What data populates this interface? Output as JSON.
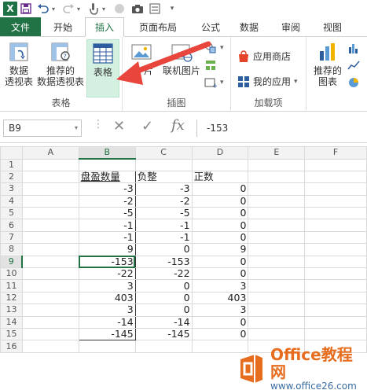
{
  "quick_access": {
    "logo": "X"
  },
  "tabs": [
    {
      "label": "文件"
    },
    {
      "label": "开始"
    },
    {
      "label": "插入"
    },
    {
      "label": "页面布局"
    },
    {
      "label": "公式"
    },
    {
      "label": "数据"
    },
    {
      "label": "审阅"
    },
    {
      "label": "视图"
    }
  ],
  "ribbon": {
    "tables_group": {
      "label": "表格",
      "pivot_line1": "数据",
      "pivot_line2": "透视表",
      "rec_pivot_line1": "推荐的",
      "rec_pivot_line2": "数据透视表",
      "table_label": "表格"
    },
    "illustrations_group": {
      "label": "插图",
      "pictures_suffix": "片",
      "online_pictures": "联机图片"
    },
    "addins_group": {
      "label": "加载项",
      "store": "应用商店",
      "my_apps": "我的应用"
    },
    "charts_group": {
      "rec_charts_line1": "推荐的",
      "rec_charts_line2": "图表"
    }
  },
  "formula_bar": {
    "name_box": "B9",
    "fx": "fx",
    "value": "-153"
  },
  "columns": [
    "A",
    "B",
    "C",
    "D",
    "E",
    "F"
  ],
  "rows": [
    {
      "n": "1",
      "A": "",
      "B": "",
      "C": "",
      "D": ""
    },
    {
      "n": "2",
      "A": "",
      "B": "盘盈数量",
      "C": "负整",
      "D": "正数"
    },
    {
      "n": "3",
      "A": "",
      "B": "-3",
      "C": "-3",
      "D": "0"
    },
    {
      "n": "4",
      "A": "",
      "B": "-2",
      "C": "-2",
      "D": "0"
    },
    {
      "n": "5",
      "A": "",
      "B": "-5",
      "C": "-5",
      "D": "0"
    },
    {
      "n": "6",
      "A": "",
      "B": "-1",
      "C": "-1",
      "D": "0"
    },
    {
      "n": "7",
      "A": "",
      "B": "-1",
      "C": "-1",
      "D": "0"
    },
    {
      "n": "8",
      "A": "",
      "B": "9",
      "C": "0",
      "D": "9"
    },
    {
      "n": "9",
      "A": "",
      "B": "-153",
      "C": "-153",
      "D": "0"
    },
    {
      "n": "10",
      "A": "",
      "B": "-22",
      "C": "-22",
      "D": "0"
    },
    {
      "n": "11",
      "A": "",
      "B": "3",
      "C": "0",
      "D": "3"
    },
    {
      "n": "12",
      "A": "",
      "B": "403",
      "C": "0",
      "D": "403"
    },
    {
      "n": "13",
      "A": "",
      "B": "3",
      "C": "0",
      "D": "3"
    },
    {
      "n": "14",
      "A": "",
      "B": "-14",
      "C": "-14",
      "D": "0"
    },
    {
      "n": "15",
      "A": "",
      "B": "-145",
      "C": "-145",
      "D": "0"
    },
    {
      "n": "16",
      "A": "",
      "B": "",
      "C": "",
      "D": ""
    }
  ],
  "watermark": {
    "title": "Office教程网",
    "url": "www.office26.com"
  },
  "colors": {
    "excel_green": "#217346",
    "arrow_red": "#e8453c",
    "watermark_orange": "#e66c1e"
  }
}
